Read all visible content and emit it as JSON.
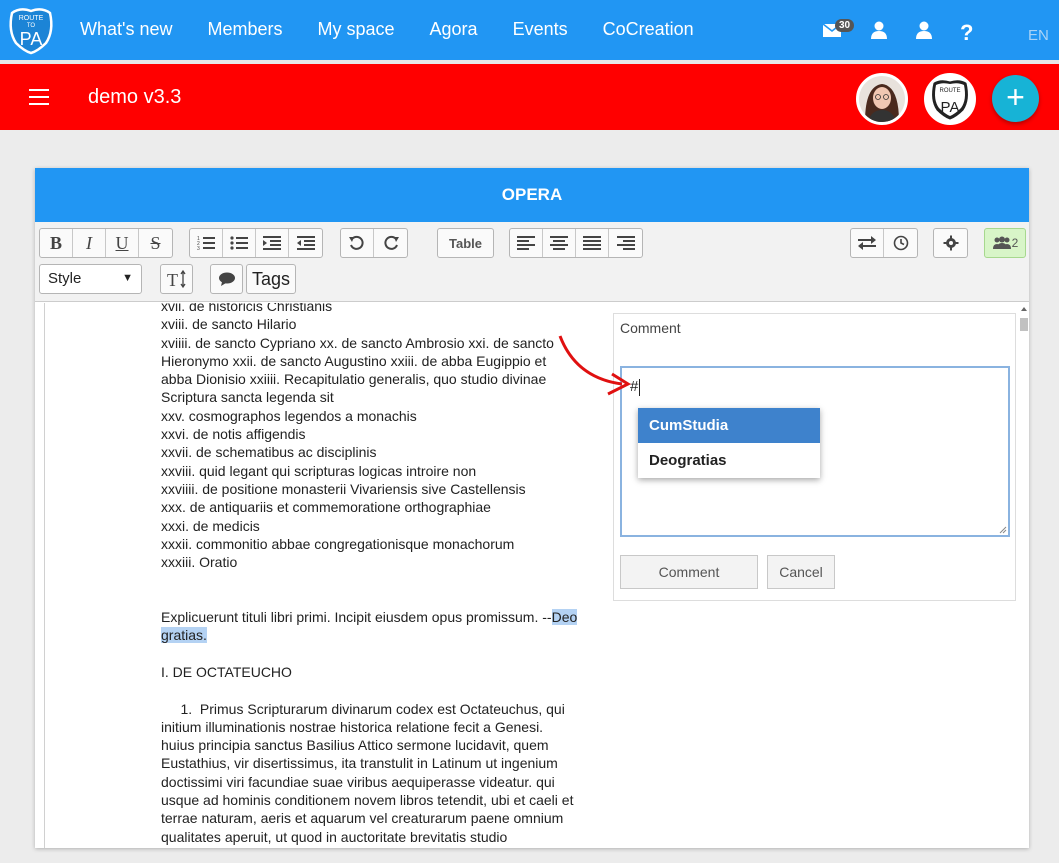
{
  "topnav": {
    "brand_top": "ROUTE",
    "brand_mid": "TO",
    "brand_main": "PA",
    "links": [
      "What's new",
      "Members",
      "My space",
      "Agora",
      "Events",
      "CoCreation"
    ],
    "mail_count": "30",
    "help": "?",
    "language": "EN"
  },
  "workspace": {
    "title": "demo v3.3",
    "add": "+"
  },
  "editor": {
    "title": "OPERA",
    "bold": "B",
    "italic": "I",
    "underline": "U",
    "strike": "S",
    "table_label": "Table",
    "style_value": "Style",
    "tags_label": "Tags",
    "collaborators_count": "2"
  },
  "document": {
    "lines": [
      "xvii. de historicis Christianis",
      "xviii. de sancto Hilario",
      "xviiii. de  sancto  Cypriano  xx. de  sancto  Ambrosio  xxi. de sancto",
      "Hieronymo  xxii. de sancto Augustino  xxiii. de abba Eugippio et",
      "abba Dionisio xxiiii. Recapitulatio generalis, quo studio divinae",
      "Scriptura sancta legenda sit",
      "xxv. cosmographos legendos a monachis",
      "xxvi. de notis affigendis",
      "xxvii. de schematibus ac disciplinis",
      "xxviii. quid legant qui scripturas logicas introire non",
      "xxviiii. de positione monasterii Vivariensis sive Castellensis",
      "xxx. de antiquariis et commemoratione orthographiae",
      "xxxi. de medicis",
      "xxxii. commonitio abbae congregationisque monachorum",
      "xxxiii. Oratio"
    ],
    "explicit_prefix": "Explicuerunt tituli libri primi.  Incipit eiusdem opus promissum.  --",
    "explicit_hl1": "Deo",
    "explicit_hl2": "gratias.",
    "heading": "I. DE OCTATEUCHO",
    "para": [
      "     1.  Primus Scripturarum divinarum codex est Octateuchus, qui",
      "initium illuminationis nostrae historica relatione fecit a Genesi.",
      "huius principia sanctus Basilius Attico sermone lucidavit, quem",
      "Eustathius, vir disertissimus, ita transtulit in Latinum ut ingenium",
      "doctissimi viri facundiae suae viribus aequiperasse videatur.  qui",
      "usque ad hominis conditionem novem libros tetendit, ubi et caeli et",
      "terrae naturam, aeris et aquarum vel creaturarum paene omnium",
      "qualitates aperuit, ut quod in auctoritate brevitatis studio"
    ]
  },
  "comment": {
    "label": "Comment",
    "input_value": "#",
    "suggestions": [
      "CumStudia",
      "Deogratias"
    ],
    "submit_label": "Comment",
    "cancel_label": "Cancel"
  },
  "colors": {
    "nav_blue": "#2196f3",
    "workspace_red": "#ff0000",
    "fab_teal": "#17b3d6",
    "suggestion_active": "#3e82cc",
    "annotation_arrow": "#e01010"
  }
}
